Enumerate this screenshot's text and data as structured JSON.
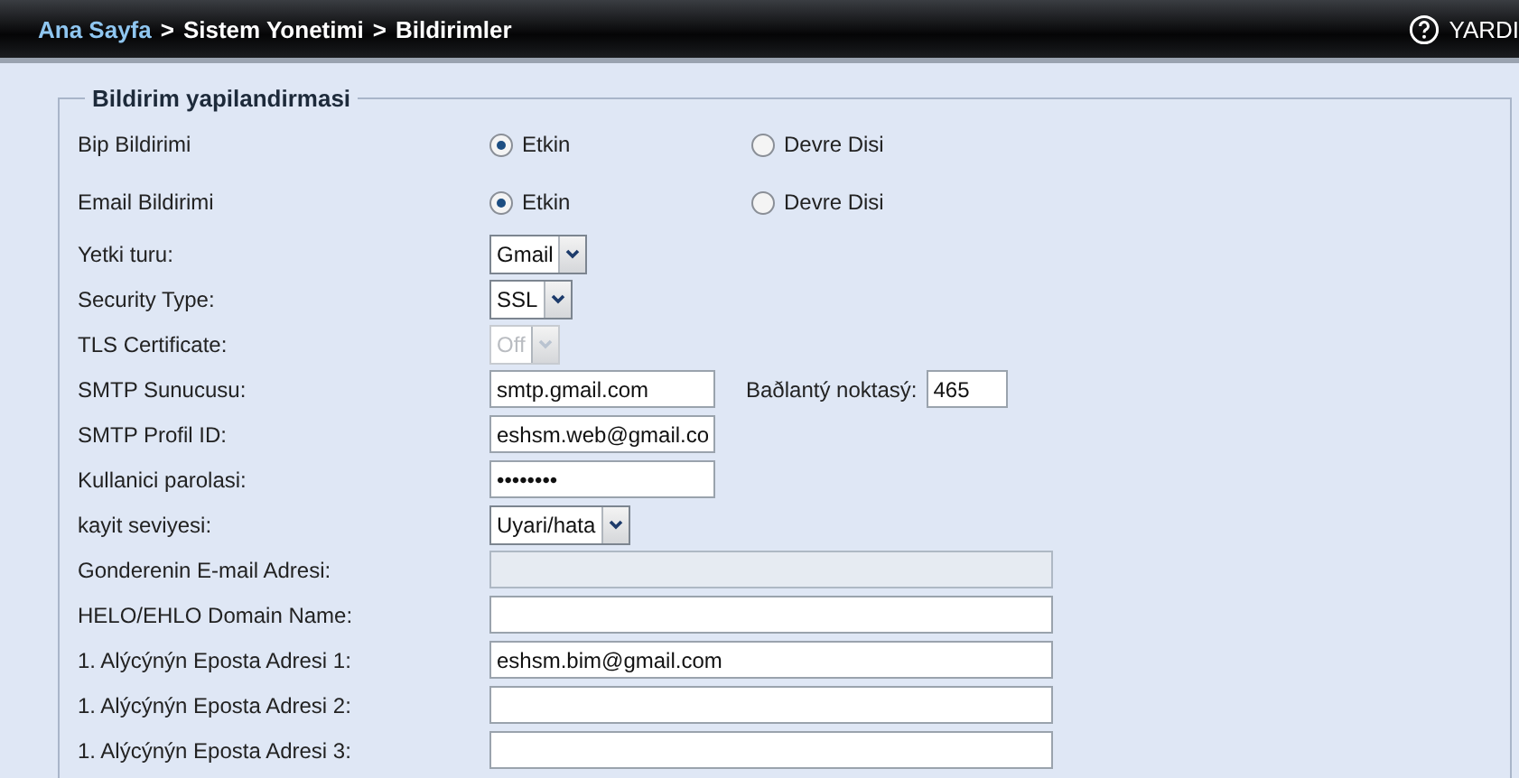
{
  "breadcrumb": {
    "home": "Ana Sayfa",
    "separator_1": ">",
    "section": "Sistem Yonetimi",
    "separator_2": ">",
    "page": "Bildirimler"
  },
  "help": {
    "label": "YARDI"
  },
  "fieldset": {
    "legend": "Bildirim yapilandirmasi"
  },
  "rows": [
    {
      "kind": "radio",
      "label": "Bip Bildirimi",
      "options": [
        {
          "label": "Etkin",
          "selected": true
        },
        {
          "label": "Devre Disi",
          "selected": false
        }
      ]
    },
    {
      "kind": "radio",
      "label": "Email Bildirimi",
      "options": [
        {
          "label": "Etkin",
          "selected": true
        },
        {
          "label": "Devre Disi",
          "selected": false
        }
      ]
    },
    {
      "kind": "select",
      "label": "Yetki turu:",
      "value": "Gmail",
      "disabled": false
    },
    {
      "kind": "select",
      "label": "Security Type:",
      "value": "SSL",
      "disabled": false
    },
    {
      "kind": "select",
      "label": "TLS Certificate:",
      "value": "Off",
      "disabled": true
    },
    {
      "kind": "text",
      "label": "SMTP Sunucusu:",
      "value": "smtp.gmail.com",
      "extra": {
        "label": "Baðlantý noktasý:",
        "value": "465"
      }
    },
    {
      "kind": "text",
      "label": "SMTP Profil ID:",
      "value": "eshsm.web@gmail.co"
    },
    {
      "kind": "text",
      "label": "Kullanici parolasi:",
      "value": "••••••••"
    },
    {
      "kind": "select",
      "label": "kayit seviyesi:",
      "value": "Uyari/hata",
      "disabled": false
    },
    {
      "kind": "wide",
      "label": "Gonderenin E-mail Adresi:",
      "value": "",
      "disabled": true
    },
    {
      "kind": "wide",
      "label": "HELO/EHLO Domain Name:",
      "value": "",
      "disabled": false
    },
    {
      "kind": "wide",
      "label": "1. Alýcýnýn Eposta Adresi 1:",
      "value": "eshsm.bim@gmail.com",
      "disabled": false
    },
    {
      "kind": "wide",
      "label": "1. Alýcýnýn Eposta Adresi 2:",
      "value": "",
      "disabled": false
    },
    {
      "kind": "wide",
      "label": "1. Alýcýnýn Eposta Adresi 3:",
      "value": "",
      "disabled": false
    }
  ]
}
